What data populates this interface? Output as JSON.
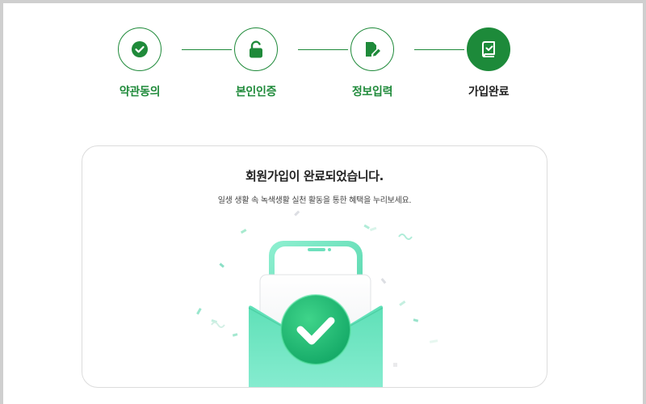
{
  "stepper": {
    "steps": [
      {
        "label": "약관동의",
        "icon": "check-icon",
        "state": "done"
      },
      {
        "label": "본인인증",
        "icon": "unlock-icon",
        "state": "done"
      },
      {
        "label": "정보입력",
        "icon": "edit-document-icon",
        "state": "done"
      },
      {
        "label": "가입완료",
        "icon": "completed-book-icon",
        "state": "active"
      }
    ]
  },
  "card": {
    "title": "회원가입이 완료되었습니다.",
    "subtitle": "일생 생활 속 녹색생활 실천 활동을 통한 혜택을 누리보세요.",
    "illustration": "phone-envelope-check-illustration"
  },
  "colors": {
    "brand_green": "#1f8a3a",
    "mint": "#6fe0bd",
    "check_green": "#22b573"
  }
}
